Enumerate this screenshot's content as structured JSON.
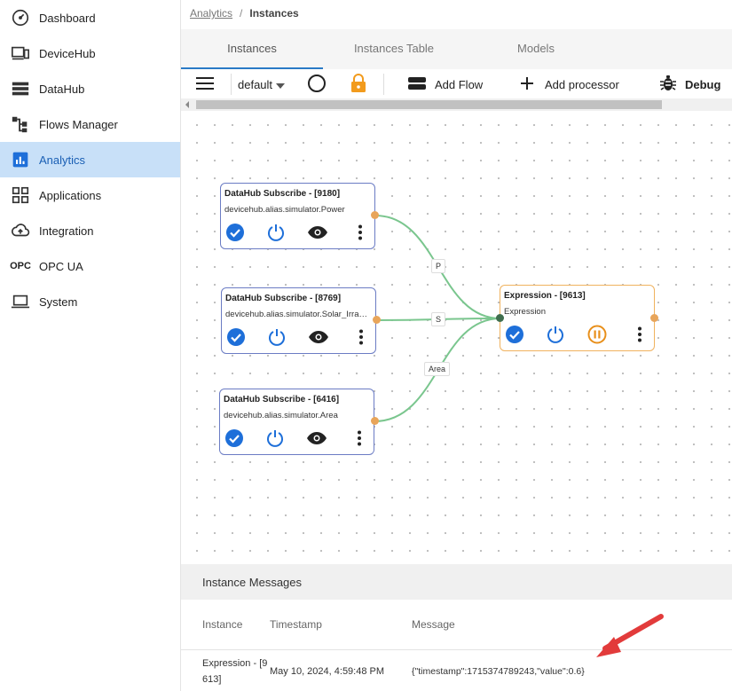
{
  "sidebar": {
    "items": [
      {
        "label": "Dashboard",
        "icon": "dashboard-gauge-icon"
      },
      {
        "label": "DeviceHub",
        "icon": "devices-icon"
      },
      {
        "label": "DataHub",
        "icon": "storage-stack-icon"
      },
      {
        "label": "Flows Manager",
        "icon": "flow-tree-icon"
      },
      {
        "label": "Analytics",
        "icon": "analytics-chart-icon",
        "active": true
      },
      {
        "label": "Applications",
        "icon": "apps-grid-icon"
      },
      {
        "label": "Integration",
        "icon": "cloud-upload-icon"
      },
      {
        "label": "OPC UA",
        "icon": "opc-text-icon",
        "icon_text": "OPC"
      },
      {
        "label": "System",
        "icon": "laptop-icon"
      }
    ]
  },
  "breadcrumb": {
    "parent": "Analytics",
    "separator": "/",
    "current": "Instances"
  },
  "tabs": [
    {
      "label": "Instances",
      "active": true
    },
    {
      "label": "Instances Table"
    },
    {
      "label": "Models"
    }
  ],
  "toolbar": {
    "menu_icon": "hamburger-menu-icon",
    "flow_select": "default",
    "add_flow": "Add Flow",
    "add_processor": "Add processor",
    "debug": "Debug"
  },
  "nodes": [
    {
      "title": "DataHub Subscribe - [9180]",
      "subtitle": "devicehub.alias.simulator.Power"
    },
    {
      "title": "DataHub Subscribe - [8769]",
      "subtitle": "devicehub.alias.simulator.Solar_Irradiance"
    },
    {
      "title": "DataHub Subscribe - [6416]",
      "subtitle": "devicehub.alias.simulator.Area"
    },
    {
      "title": "Expression - [9613]",
      "subtitle": "Expression"
    }
  ],
  "edge_labels": [
    "P",
    "S",
    "Area"
  ],
  "messages": {
    "title": "Instance Messages",
    "columns": [
      "Instance",
      "Timestamp",
      "Message"
    ],
    "rows": [
      {
        "instance_line1": "Expression - [9",
        "instance_line2": "613]",
        "timestamp": "May 10, 2024, 4:59:48 PM",
        "message": "{\"timestamp\":1715374789243,\"value\":0.6}"
      }
    ]
  },
  "colors": {
    "active_nav_bg": "#c8e0f8",
    "node_border": "#6b7cc4",
    "expression_border": "#f0b25e",
    "check_blue": "#1e6fd9",
    "edge_green": "#7ac68e",
    "lock_orange": "#f29b1d",
    "annotation_arrow": "#e23b3b"
  }
}
